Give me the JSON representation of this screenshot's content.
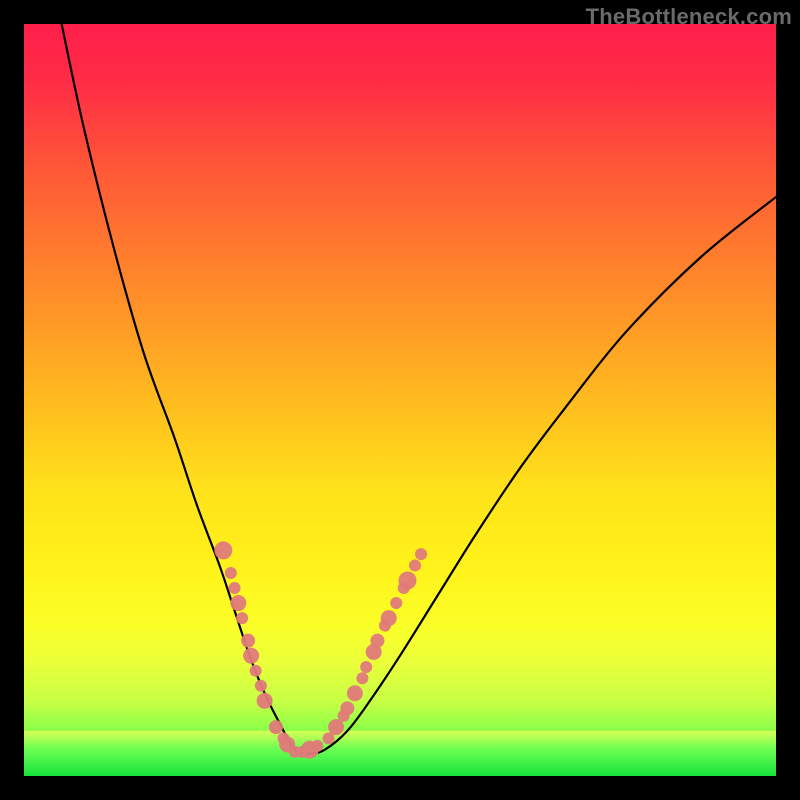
{
  "watermark": "TheBottleneck.com",
  "colors": {
    "frame_bg": "#000000",
    "curve": "#000000",
    "dot_fill": "#e07a7a",
    "dot_stroke": "#9c4444",
    "green_band_top": "#33ff57",
    "green_band_bottom": "#14e23c",
    "gradient_stops": [
      {
        "offset": 0.0,
        "color": "#ff1f4b"
      },
      {
        "offset": 0.08,
        "color": "#ff2d45"
      },
      {
        "offset": 0.2,
        "color": "#ff5a36"
      },
      {
        "offset": 0.35,
        "color": "#ff8a2a"
      },
      {
        "offset": 0.5,
        "color": "#ffbb1f"
      },
      {
        "offset": 0.62,
        "color": "#ffe21a"
      },
      {
        "offset": 0.72,
        "color": "#fff21a"
      },
      {
        "offset": 0.8,
        "color": "#fbff28"
      },
      {
        "offset": 0.85,
        "color": "#eaff3a"
      },
      {
        "offset": 0.9,
        "color": "#c7ff45"
      },
      {
        "offset": 0.95,
        "color": "#7bff4a"
      },
      {
        "offset": 1.0,
        "color": "#16e63e"
      }
    ]
  },
  "chart_data": {
    "type": "line",
    "title": "",
    "xlabel": "",
    "ylabel": "",
    "xlim": [
      0,
      100
    ],
    "ylim": [
      0,
      100
    ],
    "grid": false,
    "legend": false,
    "notes": "V-shaped bottleneck curve. No axis ticks or labels are rendered in the image; x/y values below are read in percent of plot width/height (0,0 = top-left of colored square). Minimum of the curve is near x≈36, y≈97.",
    "series": [
      {
        "name": "bottleneck-curve",
        "x": [
          5,
          8,
          12,
          16,
          20,
          23,
          26,
          28,
          30,
          32,
          34,
          36,
          38,
          40,
          43,
          46,
          50,
          55,
          60,
          66,
          72,
          80,
          90,
          100
        ],
        "y": [
          0,
          14,
          30,
          44,
          55,
          64,
          72,
          78,
          84,
          89,
          93,
          96.5,
          97,
          96.5,
          94,
          90,
          84,
          76,
          68,
          59,
          51,
          41,
          31,
          23
        ]
      }
    ],
    "dots": {
      "name": "highlight-dots",
      "note": "Salmon/pink dots clustered along the lower part of the V, roughly where bottleneck < ~30%.",
      "points": [
        {
          "x": 26.5,
          "y": 70
        },
        {
          "x": 27.5,
          "y": 73
        },
        {
          "x": 28.0,
          "y": 75
        },
        {
          "x": 28.5,
          "y": 77
        },
        {
          "x": 29.0,
          "y": 79
        },
        {
          "x": 29.8,
          "y": 82
        },
        {
          "x": 30.2,
          "y": 84
        },
        {
          "x": 30.8,
          "y": 86
        },
        {
          "x": 31.5,
          "y": 88
        },
        {
          "x": 32.0,
          "y": 90
        },
        {
          "x": 33.5,
          "y": 93.5
        },
        {
          "x": 34.5,
          "y": 95
        },
        {
          "x": 35.0,
          "y": 95.8
        },
        {
          "x": 36.0,
          "y": 96.8
        },
        {
          "x": 37.0,
          "y": 96.8
        },
        {
          "x": 38.0,
          "y": 96.5
        },
        {
          "x": 39.0,
          "y": 96
        },
        {
          "x": 40.5,
          "y": 95
        },
        {
          "x": 41.5,
          "y": 93.5
        },
        {
          "x": 42.5,
          "y": 92
        },
        {
          "x": 43.0,
          "y": 91
        },
        {
          "x": 44.0,
          "y": 89
        },
        {
          "x": 45.0,
          "y": 87
        },
        {
          "x": 45.5,
          "y": 85.5
        },
        {
          "x": 46.5,
          "y": 83.5
        },
        {
          "x": 47.0,
          "y": 82
        },
        {
          "x": 48.0,
          "y": 80
        },
        {
          "x": 48.5,
          "y": 79
        },
        {
          "x": 49.5,
          "y": 77
        },
        {
          "x": 50.5,
          "y": 75
        },
        {
          "x": 51.0,
          "y": 74
        },
        {
          "x": 52.0,
          "y": 72
        },
        {
          "x": 52.8,
          "y": 70.5
        }
      ]
    },
    "green_band": {
      "y_top": 94,
      "y_bottom": 100
    }
  }
}
